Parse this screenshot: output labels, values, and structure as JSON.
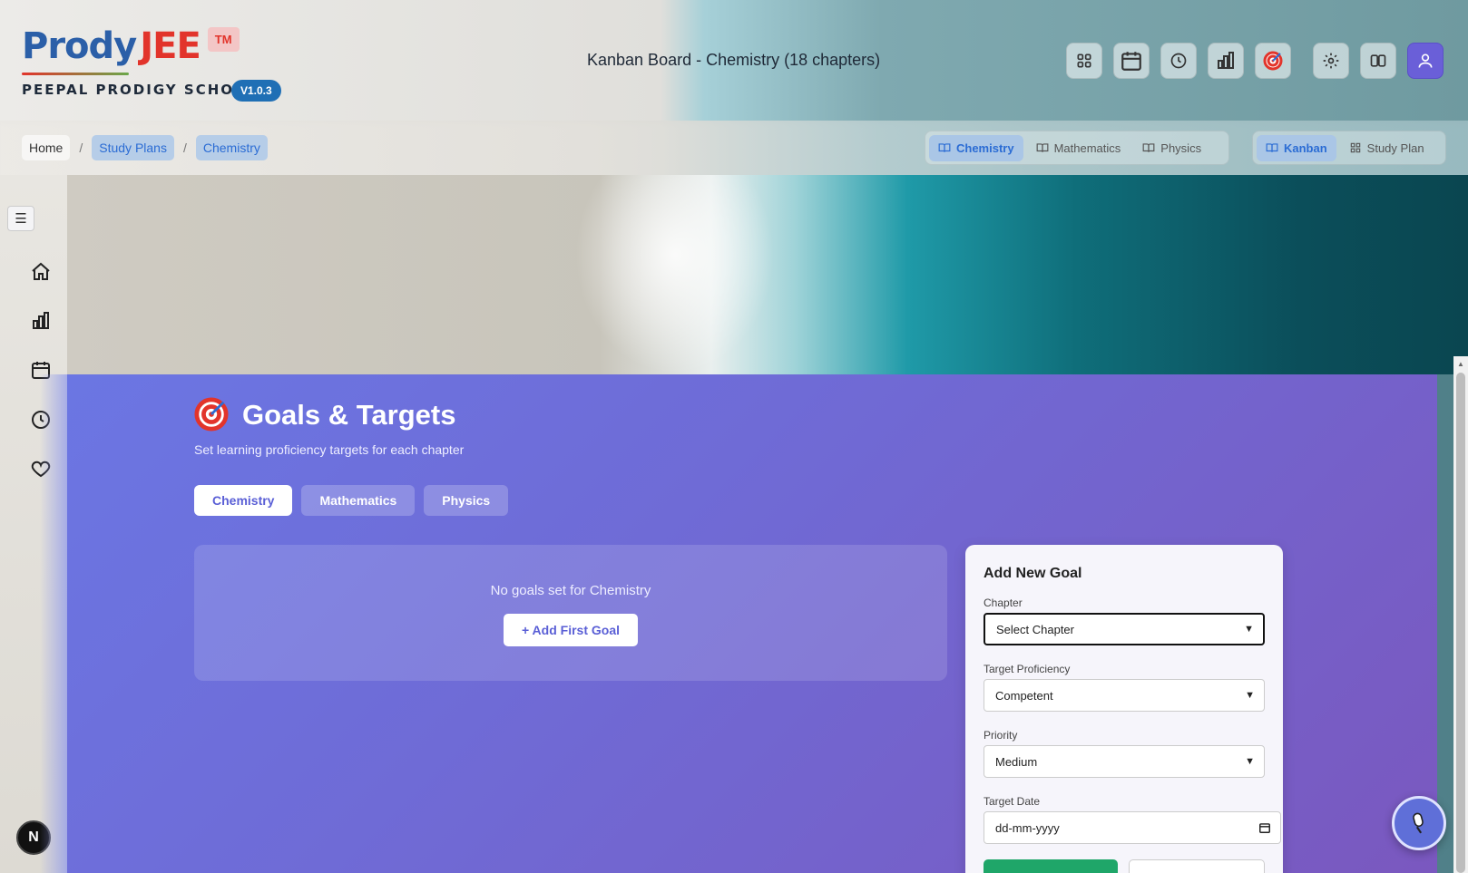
{
  "header": {
    "logo_prody": "Prody",
    "logo_jee": "JEE",
    "logo_tm": "TM",
    "school": "PEEPAL PRODIGY SCHOOL",
    "version": "V1.0.3",
    "title": "Kanban Board - Chemistry (18 chapters)",
    "buttons": [
      "grid-icon",
      "calendar-icon",
      "clock-icon",
      "bar-chart-icon",
      "target-icon",
      "gear-icon",
      "columns-icon",
      "user-icon"
    ]
  },
  "breadcrumb": {
    "items": [
      "Home",
      "Study Plans",
      "Chemistry"
    ],
    "separator": "/"
  },
  "subject_switch": [
    "Chemistry",
    "Mathematics",
    "Physics"
  ],
  "view_switch": [
    "Kanban",
    "Study Plan"
  ],
  "sidebar": {
    "menu_icon": "☰",
    "items": [
      "home-icon",
      "bar-chart-icon",
      "calendar-icon",
      "clock-icon",
      "heart-icon"
    ],
    "badge": "N"
  },
  "goals": {
    "title": "Goals & Targets",
    "subtitle": "Set learning proficiency targets for each chapter",
    "tabs": [
      "Chemistry",
      "Mathematics",
      "Physics"
    ],
    "empty_text": "No goals set for Chemistry",
    "add_first": "+ Add First Goal"
  },
  "form": {
    "title": "Add New Goal",
    "chapter_label": "Chapter",
    "chapter_value": "Select Chapter",
    "proficiency_label": "Target Proficiency",
    "proficiency_value": "Competent",
    "priority_label": "Priority",
    "priority_value": "Medium",
    "date_label": "Target Date",
    "date_value": "dd-mm-yyyy"
  },
  "colors": {
    "accent": "#5a5fd6",
    "brand_blue": "#2b5fa8",
    "brand_red": "#e2342b",
    "save_green": "#1fa669"
  }
}
